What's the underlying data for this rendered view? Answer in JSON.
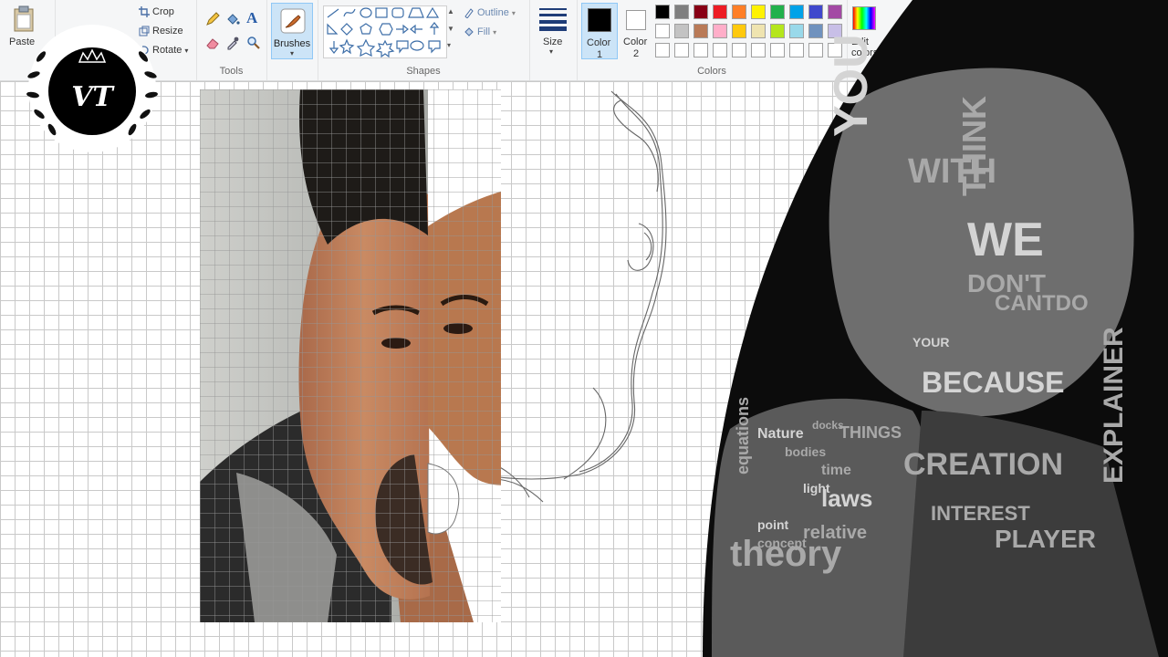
{
  "ribbon": {
    "clipboard": {
      "paste_label": "Paste"
    },
    "image": {
      "crop_label": "Crop",
      "resize_label": "Resize",
      "rotate_label": "Rotate"
    },
    "tools": {
      "group_label": "Tools"
    },
    "brushes": {
      "label": "Brushes"
    },
    "shapes": {
      "group_label": "Shapes",
      "outline_label": "Outline",
      "fill_label": "Fill"
    },
    "size": {
      "label": "Size"
    },
    "color1": {
      "label": "Color",
      "number": "1",
      "value": "#000000"
    },
    "color2": {
      "label": "Color",
      "number": "2",
      "value": "#ffffff"
    },
    "colors": {
      "group_label": "Colors"
    },
    "edit_colors": {
      "label": "Edit colors"
    },
    "palette_row1": [
      "#000000",
      "#7f7f7f",
      "#880015",
      "#ed1c24",
      "#ff7f27",
      "#fff200",
      "#22b14c",
      "#00a2e8",
      "#3f48cc",
      "#a349a4"
    ],
    "palette_row2": [
      "#ffffff",
      "#c3c3c3",
      "#b97a57",
      "#ffaec9",
      "#ffc90e",
      "#efe4b0",
      "#b5e61d",
      "#99d9ea",
      "#7092be",
      "#c8bfe7"
    ]
  },
  "logo": {
    "monogram": "VT"
  },
  "typography": {
    "words": [
      "YOU",
      "WITH",
      "THINK",
      "WE",
      "DON'T",
      "CANTDO",
      "BECAUSE",
      "THINGS",
      "time",
      "laws",
      "relative",
      "theory",
      "Nature",
      "equations",
      "bodies",
      "light",
      "docks",
      "concept",
      "point",
      "CREATION",
      "EXPLAINER",
      "YOUR",
      "PLAYER",
      "INTEREST"
    ]
  }
}
